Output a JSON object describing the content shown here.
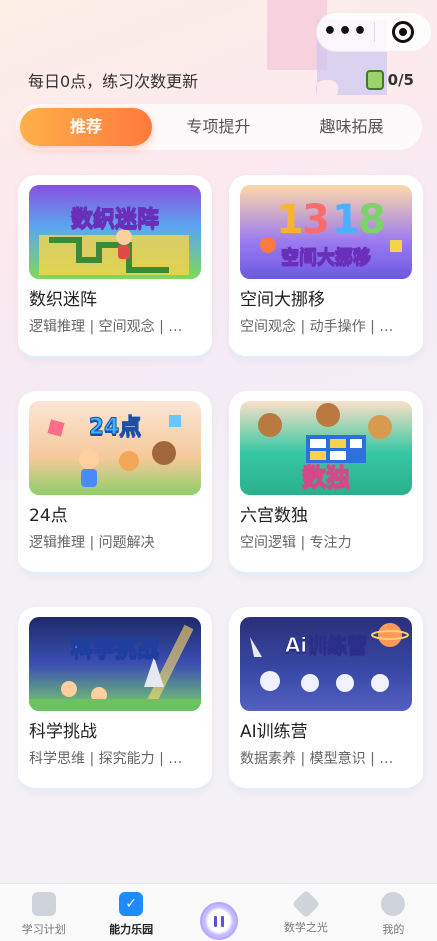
{
  "header": {
    "info_text": "每日0点，练习次数更新",
    "counter": "0/5"
  },
  "tabs": [
    {
      "label": "推荐",
      "active": true
    },
    {
      "label": "专项提升",
      "active": false
    },
    {
      "label": "趣味拓展",
      "active": false
    }
  ],
  "cards": [
    {
      "image_text": "数织迷阵",
      "title": "数织迷阵",
      "tags": "逻辑推理 | 空间观念 | …"
    },
    {
      "image_text": "空间大挪移",
      "title": "空间大挪移",
      "tags": "空间观念 | 动手操作 | …"
    },
    {
      "image_text": "24点",
      "title": "24点",
      "tags": "逻辑推理 | 问题解决"
    },
    {
      "image_text": "数独",
      "title": "六宫数独",
      "tags": "空间逻辑 | 专注力"
    },
    {
      "image_text": "科学挑战",
      "title": "科学挑战",
      "tags": "科学思维 | 探究能力 | …"
    },
    {
      "image_text": "Ai训练营",
      "title": "AI训练营",
      "tags": "数据素养 | 模型意识 | …"
    }
  ],
  "nav": [
    {
      "label": "学习计划",
      "icon": "book-icon"
    },
    {
      "label": "能力乐园",
      "icon": "checkbox-icon",
      "active": true
    },
    {
      "label": "",
      "icon": "pause-icon"
    },
    {
      "label": "数学之光",
      "icon": "sparkle-icon"
    },
    {
      "label": "我的",
      "icon": "profile-icon"
    }
  ],
  "colors": {
    "accent_start": "#ffb04a",
    "accent_end": "#ff7a3c",
    "nav_active": "#1e8bff"
  }
}
